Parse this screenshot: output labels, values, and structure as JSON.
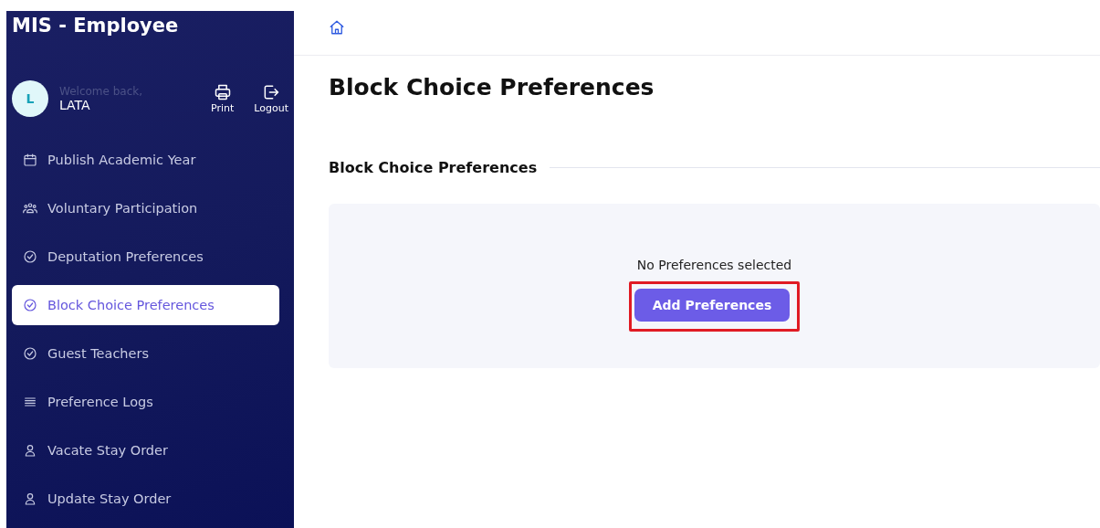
{
  "sidebar": {
    "title": "MIS - Employee",
    "user": {
      "initial": "L",
      "greeting": "Welcome back,",
      "name": "LATA"
    },
    "actions": [
      {
        "kind": "print",
        "label": "Print"
      },
      {
        "kind": "logout",
        "label": "Logout"
      }
    ],
    "items": [
      {
        "label": "Publish Academic Year",
        "kind": "calendar",
        "selected": false
      },
      {
        "label": "Voluntary Participation",
        "kind": "group",
        "selected": false
      },
      {
        "label": "Deputation Preferences",
        "kind": "check",
        "selected": false
      },
      {
        "label": "Block Choice Preferences",
        "kind": "check",
        "selected": true
      },
      {
        "label": "Guest Teachers",
        "kind": "check",
        "selected": false
      },
      {
        "label": "Preference Logs",
        "kind": "list",
        "selected": false
      },
      {
        "label": "Vacate Stay Order",
        "kind": "person",
        "selected": false
      },
      {
        "label": "Update Stay Order",
        "kind": "person",
        "selected": false
      }
    ]
  },
  "page": {
    "title": "Block Choice Preferences",
    "section_title": "Block Choice Preferences",
    "empty_message": "No Preferences selected",
    "add_button": {
      "label": "Add Preferences",
      "highlighted": true
    }
  }
}
